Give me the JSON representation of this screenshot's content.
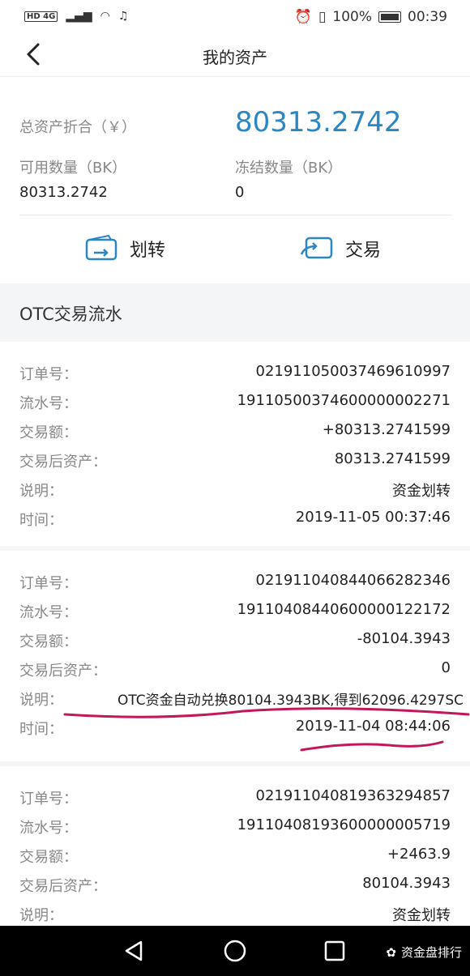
{
  "status_bar": {
    "network": "HD 4G",
    "battery": "100%",
    "time": "00:39"
  },
  "header": {
    "title": "我的资产"
  },
  "summary": {
    "total_label": "总资产折合（￥）",
    "total_value": "80313.2742",
    "available_label": "可用数量（BK）",
    "available_value": "80313.2742",
    "frozen_label": "冻结数量（BK）",
    "frozen_value": "0"
  },
  "actions": {
    "transfer_label": "划转",
    "trade_label": "交易"
  },
  "section_title": "OTC交易流水",
  "field_labels": {
    "order": "订单号：",
    "serial": "流水号：",
    "amount": "交易额：",
    "after": "交易后资产：",
    "desc": "说明：",
    "time": "时间："
  },
  "records": [
    {
      "order": "021911050037469610997",
      "serial": "19110500374600000002271",
      "amount": "+80313.2741599",
      "after": "80313.2741599",
      "desc": "资金划转",
      "time": "2019-11-05 00:37:46"
    },
    {
      "order": "021911040844066282346",
      "serial": "19110408440600000122172",
      "amount": "-80104.3943",
      "after": "0",
      "desc": "OTC资金自动兑换80104.3943BK,得到62096.4297SC",
      "time": "2019-11-04 08:44:06"
    },
    {
      "order": "021911040819363294857",
      "serial": "19110408193600000005719",
      "amount": "+2463.9",
      "after": "80104.3943",
      "desc": "资金划转"
    }
  ],
  "watermark": "资金盘排行",
  "colors": {
    "accent": "#2b86c4",
    "annotation": "#c2185b"
  }
}
